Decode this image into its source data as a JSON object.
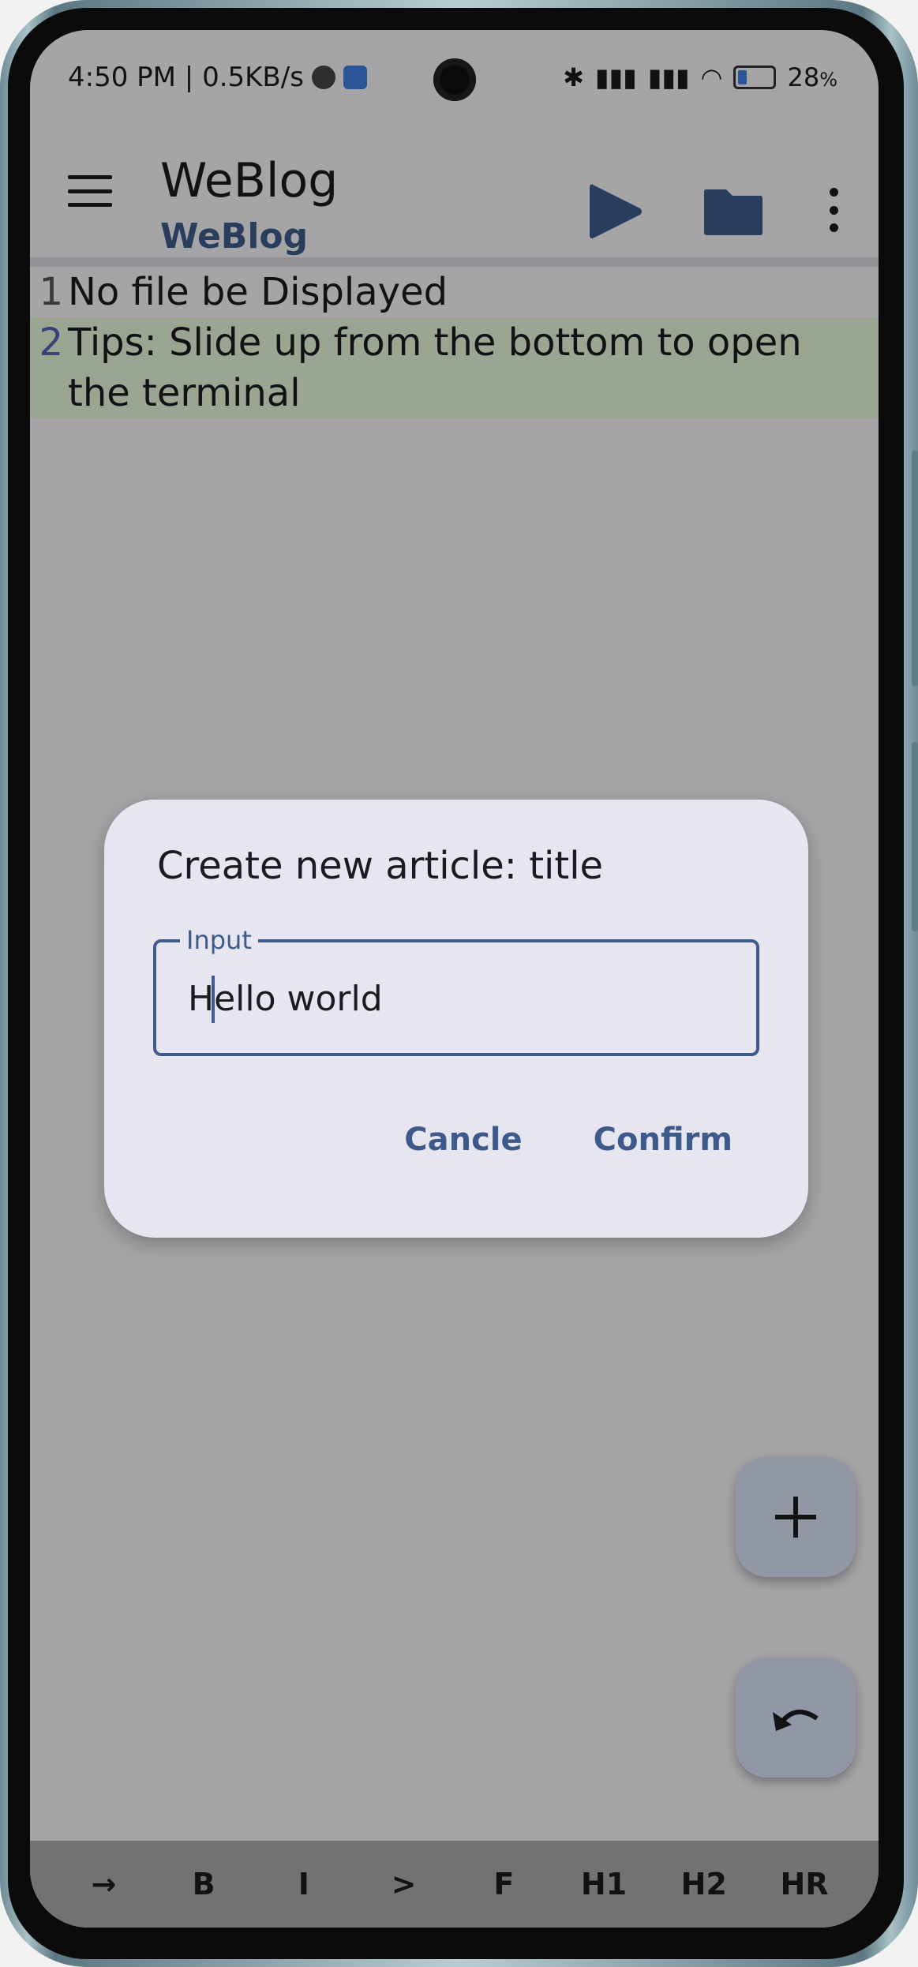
{
  "status_bar": {
    "time_speed": "4:50 PM | 0.5KB/s",
    "battery": "28",
    "battery_unit": "%",
    "battery_level": 0.28
  },
  "app_bar": {
    "title": "WeBlog",
    "subtitle": "WeBlog",
    "icons": [
      "menu-icon",
      "play-icon",
      "folder-icon",
      "more-vert-icon"
    ]
  },
  "editor": {
    "lines": [
      {
        "num": "1",
        "text": "No file be Displayed"
      },
      {
        "num": "2",
        "text": "Tips: Slide up from the bottom to open the terminal"
      }
    ]
  },
  "dialog": {
    "title": "Create new article: title",
    "input_label": "Input",
    "input_value": "Hello world",
    "cancel_label": "Cancle",
    "confirm_label": "Confirm"
  },
  "fabs": [
    "add-icon",
    "undo-icon"
  ],
  "toolbar": {
    "keys": [
      "→",
      "B",
      "I",
      ">",
      "F",
      "H1",
      "H2",
      "HR"
    ]
  },
  "colors": {
    "accent": "#3d5a8a",
    "highlight_line": "#e3f3d7",
    "dialog_bg": "#e6e6f0",
    "fab_bg": "#d6dff3"
  }
}
